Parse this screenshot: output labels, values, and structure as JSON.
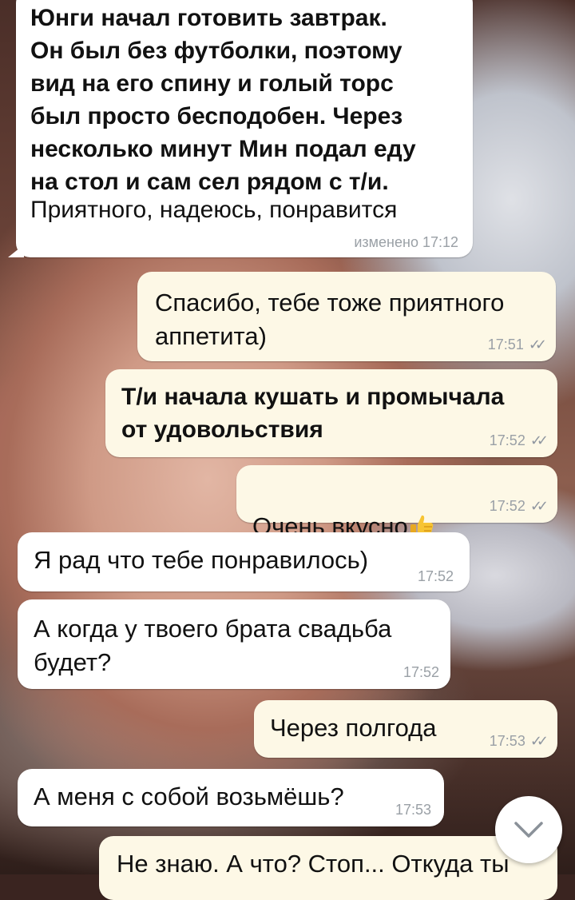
{
  "messages": [
    {
      "id": "m1",
      "direction": "in",
      "bold": true,
      "text": "Юнги начал готовить завтрак.\nОн был без футболки, поэтому\nвид на его спину и голый торс\nбыл просто бесподобен. Через\nнесколько минут Мин подал еду\nна стол и сам сел рядом с т/и.",
      "text_extra": "Приятного, надеюсь, понравится",
      "meta": "изменено 17:12"
    },
    {
      "id": "m2",
      "direction": "out",
      "bold": false,
      "text": "Спасибо, тебе тоже приятного\nаппетита)",
      "meta": "17:51"
    },
    {
      "id": "m3",
      "direction": "out",
      "bold": true,
      "text": "Т/и начала кушать и промычала\nот удовольствия",
      "meta": "17:52"
    },
    {
      "id": "m4",
      "direction": "out",
      "bold": false,
      "text": "Очень вкусно",
      "emoji": "thumbs-up",
      "meta": "17:52"
    },
    {
      "id": "m5",
      "direction": "in",
      "bold": false,
      "text": "Я рад что тебе понравилось)",
      "meta": "17:52"
    },
    {
      "id": "m6",
      "direction": "in",
      "bold": false,
      "text": "А когда у твоего брата свадьба\nбудет?",
      "meta": "17:52"
    },
    {
      "id": "m7",
      "direction": "out",
      "bold": false,
      "text": "Через полгода",
      "meta": "17:53"
    },
    {
      "id": "m8",
      "direction": "in",
      "bold": false,
      "text": "А меня с собой возьмёшь?",
      "meta": "17:53"
    },
    {
      "id": "m9",
      "direction": "out",
      "bold": false,
      "text": "Не знаю. А что? Стоп... Откуда ты"
    }
  ],
  "read_ticks": "✓✓",
  "scroll_button": {
    "icon": "chevron-down-icon"
  },
  "colors": {
    "incoming": "#ffffff",
    "outgoing": "#fdf8e6",
    "meta": "#9aa0a6"
  }
}
